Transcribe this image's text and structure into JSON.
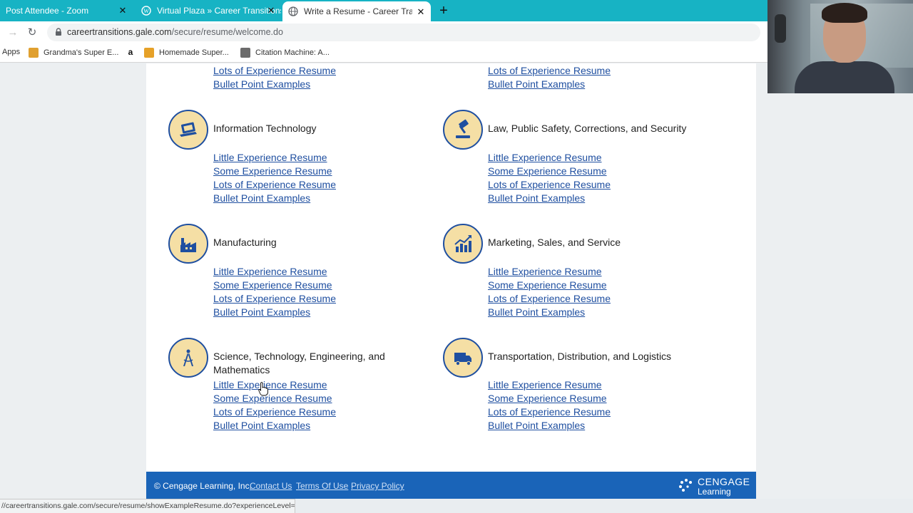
{
  "browser": {
    "tabs": [
      {
        "title": "Post Attendee - Zoom",
        "active": false
      },
      {
        "title": "Virtual Plaza » Career Transitions",
        "active": false
      },
      {
        "title": "Write a Resume - Career Transiti",
        "active": true
      }
    ],
    "url_host": "careertransitions.gale.com",
    "url_path": "/secure/resume/welcome.do",
    "bookmarks": [
      "Apps",
      "Grandma's Super E...",
      "",
      "Homemade Super...",
      "Citation Machine: A..."
    ]
  },
  "categories": [
    {
      "title": "Information Technology",
      "icon": "laptop-icon"
    },
    {
      "title": "Law, Public Safety, Corrections, and Security",
      "icon": "gavel-icon"
    },
    {
      "title": "Manufacturing",
      "icon": "factory-icon"
    },
    {
      "title": "Marketing, Sales, and Service",
      "icon": "growth-chart-icon"
    },
    {
      "title": "Science, Technology, Engineering, and",
      "title_line2": "Mathematics",
      "icon": "compass-icon"
    },
    {
      "title": "Transportation, Distribution, and Logistics",
      "icon": "truck-icon"
    }
  ],
  "links": {
    "little": "Little Experience Resume",
    "some": "Some Experience Resume",
    "lots": "Lots of Experience Resume",
    "bullet": "Bullet Point Examples"
  },
  "footer": {
    "copyright": "© Cengage Learning, Inc.",
    "contact": "Contact Us",
    "terms": "Terms Of Use",
    "privacy": "Privacy Policy",
    "brand": "CENGAGE",
    "brand_sub": "Learning"
  },
  "status_url": "//careertransitions.gale.com/secure/resume/showExampleResume.do?experienceLevel=...",
  "colors": {
    "tabbar": "#17b3c4",
    "link": "#1f4fa0",
    "footer": "#1a64b8",
    "icon_bg": "#f5dfa5"
  }
}
